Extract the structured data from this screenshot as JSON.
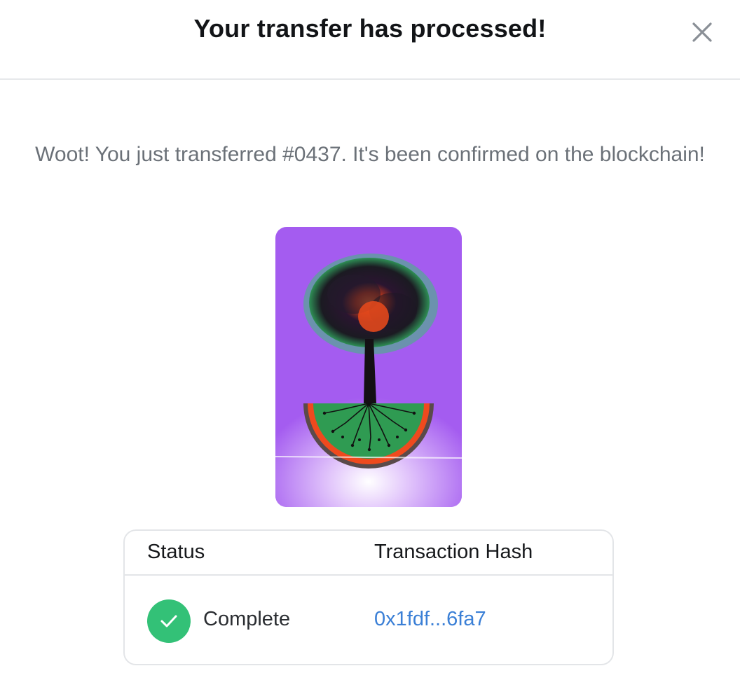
{
  "modal": {
    "title": "Your transfer has processed!",
    "close_icon": "close-icon"
  },
  "message": {
    "text": "Woot! You just transferred #0437. It's been confirmed on the blockchain!"
  },
  "nft": {
    "artwork": "tree-with-watermelon-roots",
    "background_color": "#a45cf0"
  },
  "table": {
    "headers": {
      "status": "Status",
      "hash": "Transaction Hash"
    },
    "row": {
      "status": "Complete",
      "status_icon": "check-icon",
      "status_color": "#33c177",
      "hash": "0x1fdf...6fa7",
      "hash_color": "#3a7fd6"
    }
  }
}
